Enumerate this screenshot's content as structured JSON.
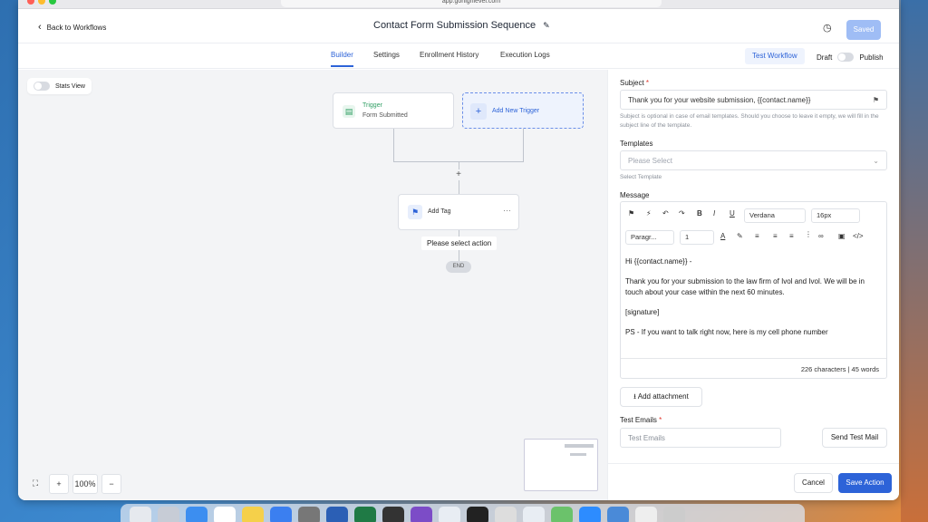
{
  "browser": {
    "url": "app.gohighlevel.com"
  },
  "header": {
    "back_label": "Back to Workflows",
    "title": "Contact Form Submission Sequence",
    "saved_label": "Saved"
  },
  "tabs": [
    {
      "label": "Builder",
      "active": true
    },
    {
      "label": "Settings",
      "active": false
    },
    {
      "label": "Enrollment History",
      "active": false
    },
    {
      "label": "Execution Logs",
      "active": false
    }
  ],
  "actions": {
    "test_workflow": "Test Workflow",
    "draft": "Draft",
    "publish": "Publish"
  },
  "canvas": {
    "stats_view": "Stats View",
    "trigger": {
      "title": "Trigger",
      "subtitle": "Form Submitted"
    },
    "add_trigger": "Add New Trigger",
    "add_tag_node": "Add Tag",
    "node_menu": "···",
    "tooltip": "Please select action",
    "end_label": "END",
    "zoom": "100%",
    "zoom_in": "+",
    "zoom_out": "−",
    "plus": "+"
  },
  "panel": {
    "subject_label": "Subject",
    "subject_value": "Thank you for your website submission, {{contact.name}}",
    "subject_help": "Subject is optional in case of email templates. Should you choose to leave it empty, we will fill in the subject line of the template.",
    "templates_label": "Templates",
    "templates_placeholder": "Please Select",
    "templates_help": "Select Template",
    "message_label": "Message",
    "font": "Verdana",
    "font_size": "16px",
    "paragraph": "Paragr...",
    "line_height": "1",
    "message_lines": [
      "Hi {{contact.name}} -",
      "Thank you for your submission to the law firm of Ivol and Ivol.  We will be in touch about your case within the next 60 minutes.",
      "[signature]",
      "PS - If you want to talk right now, here is my cell phone number"
    ],
    "counter": "226 characters | 45 words",
    "add_attachment": "Add attachment",
    "test_emails_label": "Test Emails",
    "test_emails_placeholder": "Test Emails",
    "send_test": "Send Test Mail",
    "cancel": "Cancel",
    "save_action": "Save Action"
  },
  "colors": {
    "accent": "#2d63d8",
    "trigger_green": "#2f9e63"
  }
}
